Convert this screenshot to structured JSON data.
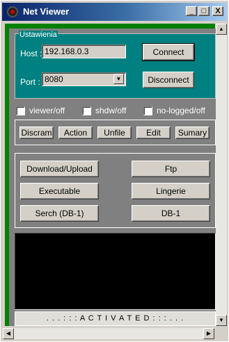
{
  "window": {
    "title": "Net Viewer",
    "minimize": "_",
    "maximize": "□",
    "close": "X"
  },
  "settings": {
    "group_title": "Ustawienia",
    "host_label": "Host :",
    "host_value": "192.168.0.3",
    "port_label": "Port :",
    "port_value": "8080",
    "connect": "Connect",
    "disconnect": "Disconnect"
  },
  "checkboxes": [
    {
      "label": "viewer/off",
      "checked": false
    },
    {
      "label": "shdw/off",
      "checked": false
    },
    {
      "label": "no-logged/off",
      "checked": false
    }
  ],
  "toolbar": [
    "Discram",
    "Action",
    "Unfile",
    "Edit",
    "Sumary"
  ],
  "actions": {
    "left": [
      "Download/Upload",
      "Executable",
      "Serch (DB-1)"
    ],
    "right": [
      "Ftp",
      "Lingerie",
      "DB-1"
    ]
  },
  "status": ". . . : : : A C T I V A T E D : : : . . ."
}
